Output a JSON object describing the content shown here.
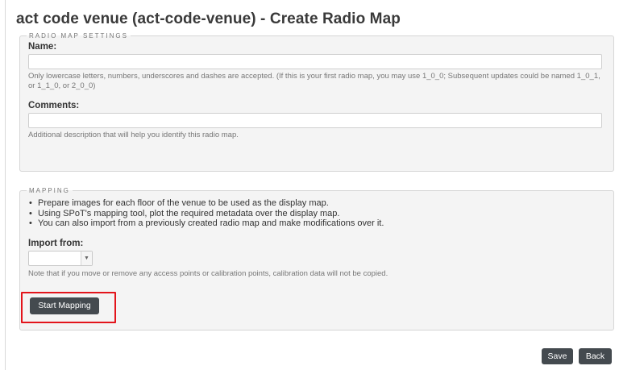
{
  "page": {
    "title": "act code venue (act-code-venue) - Create Radio Map"
  },
  "radio_map_settings": {
    "legend": "RADIO MAP SETTINGS",
    "name_label": "Name:",
    "name_value": "",
    "name_help": "Only lowercase letters, numbers, underscores and dashes are accepted. (If this is your first radio map, you may use 1_0_0; Subsequent updates could be named 1_0_1, or 1_1_0, or 2_0_0)",
    "comments_label": "Comments:",
    "comments_value": "",
    "comments_help": "Additional description that will help you identify this radio map."
  },
  "mapping": {
    "legend": "MAPPING",
    "bullets": [
      "Prepare images for each floor of the venue to be used as the display map.",
      "Using SPoT's mapping tool, plot the required metadata over the display map.",
      "You can also import from a previously created radio map and make modifications over it."
    ],
    "import_label": "Import from:",
    "import_selected": "",
    "import_note": "Note that if you move or remove any access points or calibration points, calibration data will not be copied.",
    "start_button": "Start Mapping"
  },
  "footer": {
    "save_button": "Save",
    "back_button": "Back"
  },
  "colors": {
    "highlight": "#e3141b",
    "button_bg": "#444a4f",
    "panel_bg": "#f4f4f4"
  }
}
